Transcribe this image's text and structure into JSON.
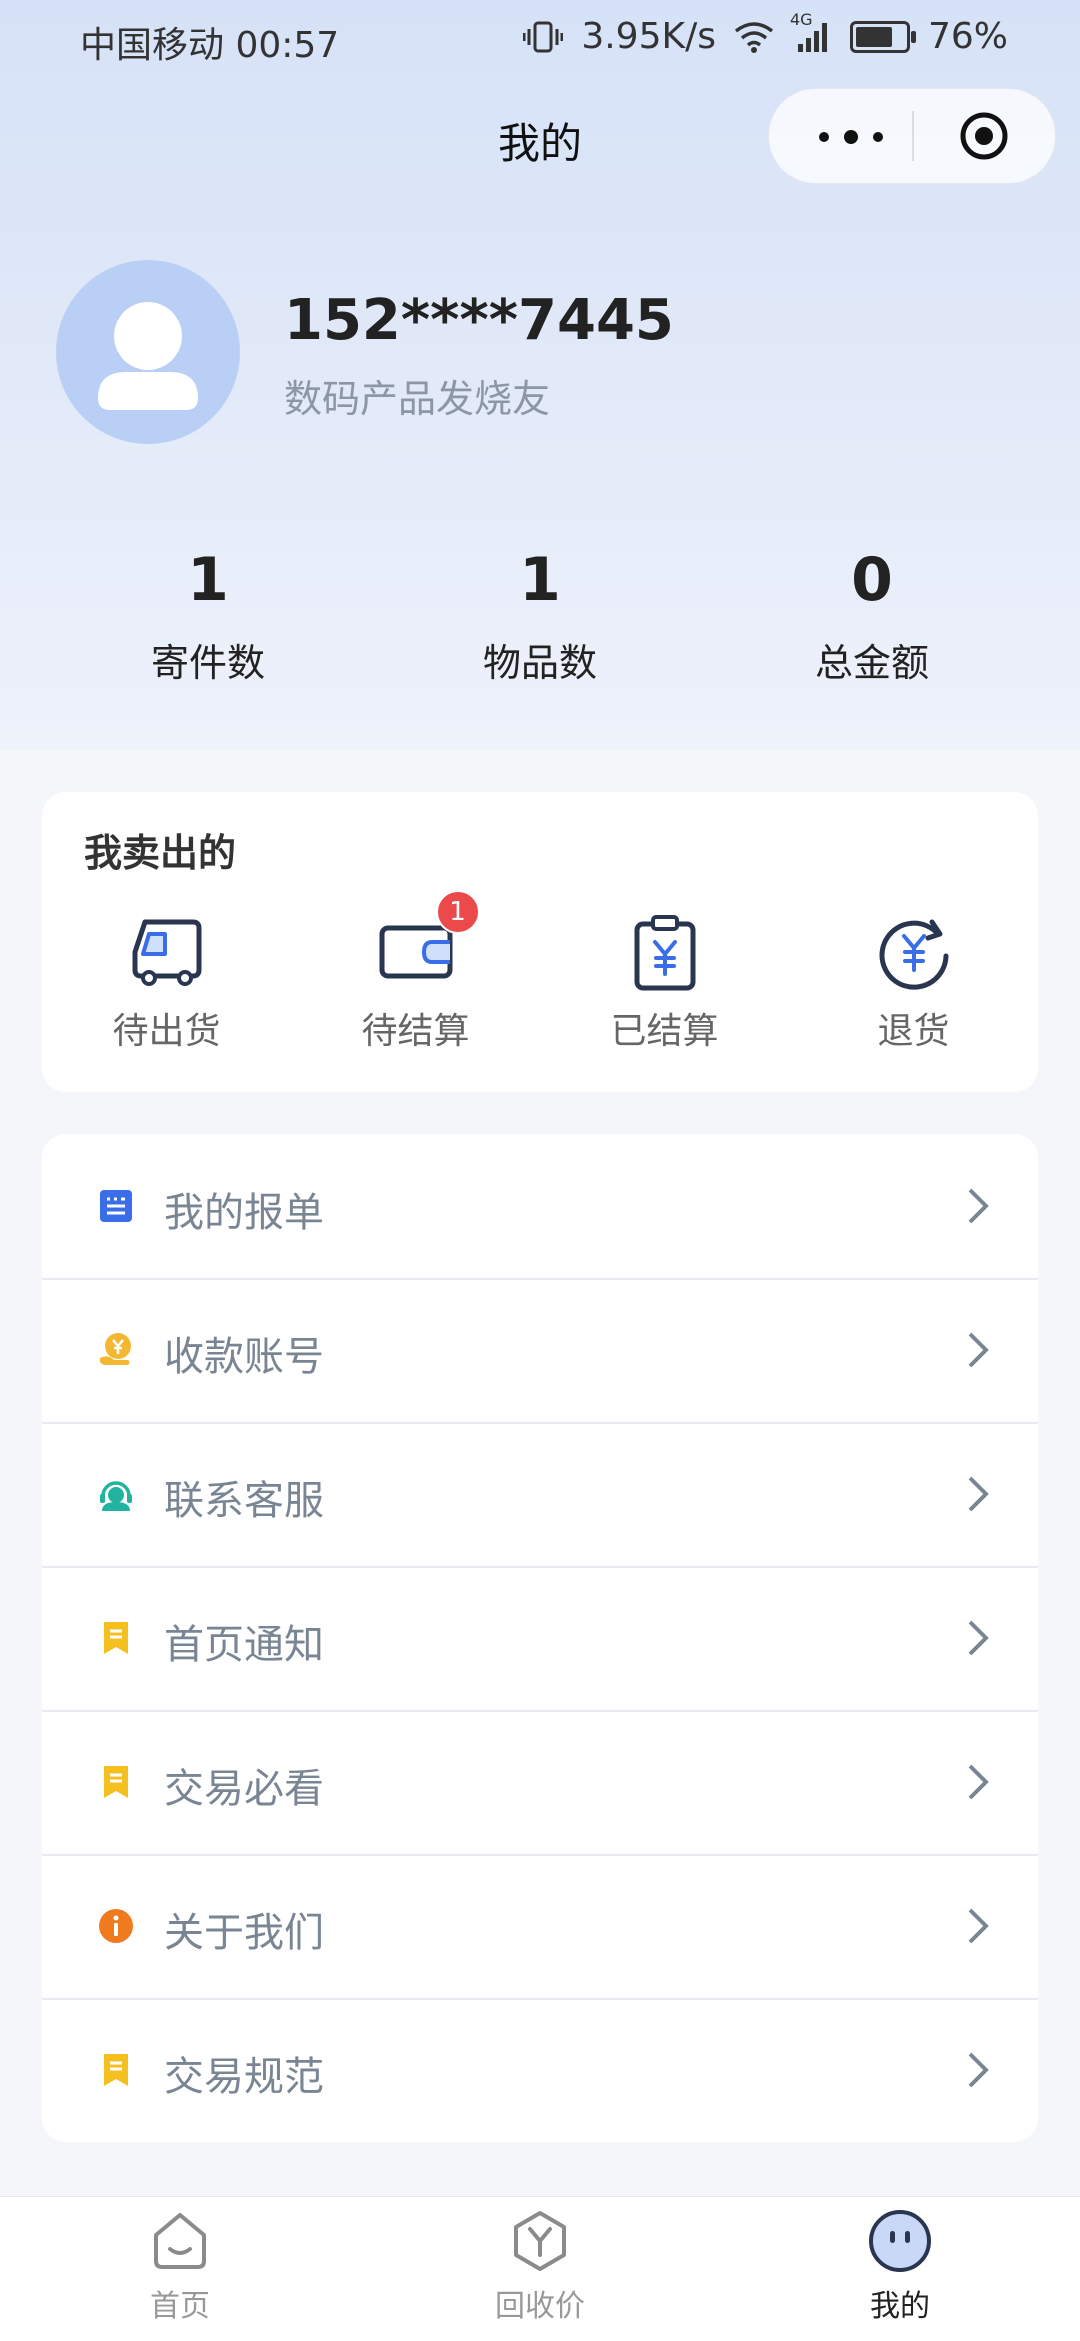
{
  "status_bar": {
    "carrier": "中国移动",
    "time": "00:57",
    "net_speed": "3.95K/s",
    "network": "4G",
    "battery": "76%",
    "battery_level": 0.76
  },
  "header": {
    "title": "我的"
  },
  "profile": {
    "phone": "152****7445",
    "tag": "数码产品发烧友"
  },
  "stats": [
    {
      "value": "1",
      "label": "寄件数"
    },
    {
      "value": "1",
      "label": "物品数"
    },
    {
      "value": "0",
      "label": "总金额"
    }
  ],
  "sold": {
    "title": "我卖出的",
    "items": [
      {
        "label": "待出货",
        "icon": "truck-icon"
      },
      {
        "label": "待结算",
        "icon": "wallet-icon",
        "badge": "1"
      },
      {
        "label": "已结算",
        "icon": "clipboard-yen-icon"
      },
      {
        "label": "退货",
        "icon": "refund-yen-icon"
      }
    ]
  },
  "menu": [
    {
      "label": "我的报单",
      "icon": "report-icon",
      "color": "#3a6ee8"
    },
    {
      "label": "收款账号",
      "icon": "yen-hand-icon",
      "color": "#f4b731"
    },
    {
      "label": "联系客服",
      "icon": "support-agent-icon",
      "color": "#20b4a0"
    },
    {
      "label": "首页通知",
      "icon": "notice-icon",
      "color": "#f4c020"
    },
    {
      "label": "交易必看",
      "icon": "notice-icon",
      "color": "#f4c020"
    },
    {
      "label": "关于我们",
      "icon": "info-icon",
      "color": "#f07a1e"
    },
    {
      "label": "交易规范",
      "icon": "notice-icon",
      "color": "#f4c020"
    }
  ],
  "tabs": [
    {
      "label": "首页",
      "icon": "home-face-icon",
      "active": false
    },
    {
      "label": "回收价",
      "icon": "recycle-price-icon",
      "active": false
    },
    {
      "label": "我的",
      "icon": "mine-face-icon",
      "active": true
    }
  ]
}
